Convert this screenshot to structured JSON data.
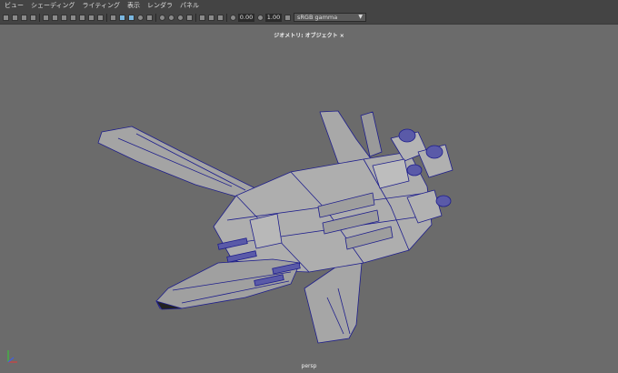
{
  "menubar": {
    "items": [
      "ビュー",
      "シェーディング",
      "ライティング",
      "表示",
      "レンダラ",
      "パネル"
    ]
  },
  "toolbar": {
    "exposure_value": "0.00",
    "gamma_value": "1.00",
    "color_space": "sRGB gamma"
  },
  "viewport": {
    "title": "ジオメトリ: オブジェクト ×",
    "camera": "persp"
  },
  "colors": {
    "viewport_bg": "#6b6b6b",
    "wire": "#1e1e8c",
    "model_fill": "#a8a8a8",
    "accent_blue": "#5a5aa8"
  }
}
